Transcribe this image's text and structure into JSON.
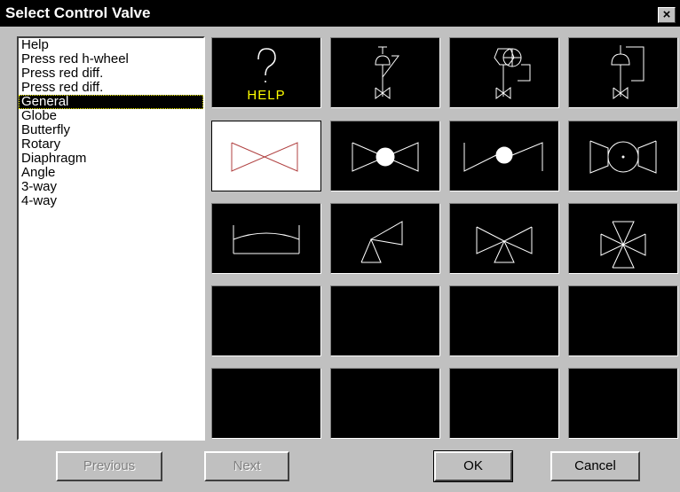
{
  "window": {
    "title": "Select Control Valve",
    "close_label": "×"
  },
  "list": {
    "items": [
      "Help",
      "Press red h-wheel",
      "Press red diff.",
      "Press red diff.",
      "General",
      "Globe",
      "Butterfly",
      "Rotary",
      "Diaphragm",
      "Angle",
      "3-way",
      "4-way"
    ],
    "selected_index": 4
  },
  "grid": {
    "help_text": "HELP",
    "symbols": [
      "help-icon",
      "valve-hand-wheel-icon",
      "valve-pressure-diff-icon",
      "valve-diaphragm-actuator-icon",
      "general-valve-icon",
      "globe-valve-icon",
      "butterfly-valve-icon",
      "rotary-valve-icon",
      "diaphragm-valve-icon",
      "angle-valve-icon",
      "three-way-valve-icon",
      "four-way-valve-icon",
      "",
      "",
      "",
      "",
      "",
      "",
      "",
      ""
    ],
    "selected_index": 4
  },
  "buttons": {
    "previous": "Previous",
    "next": "Next",
    "ok": "OK",
    "cancel": "Cancel"
  },
  "colors": {
    "accent_help": "#ffff00",
    "symbol_line": "#ffffff",
    "selected_symbol": "#b04040"
  }
}
